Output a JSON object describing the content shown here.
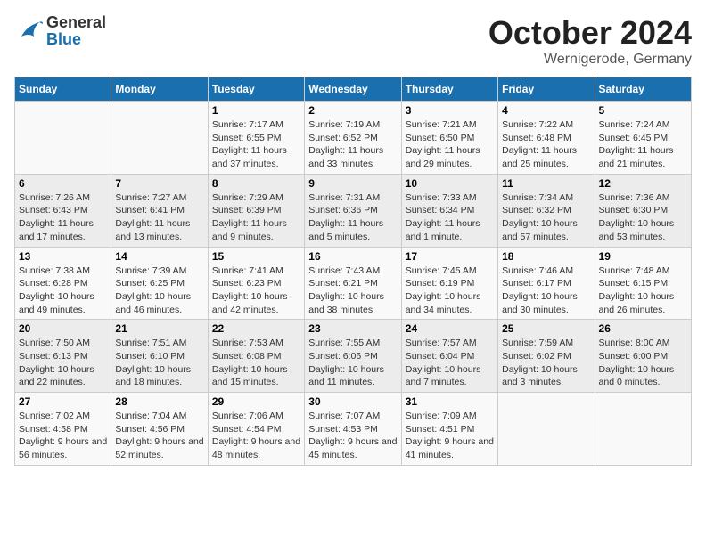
{
  "header": {
    "logo_general": "General",
    "logo_blue": "Blue",
    "month": "October 2024",
    "location": "Wernigerode, Germany"
  },
  "weekdays": [
    "Sunday",
    "Monday",
    "Tuesday",
    "Wednesday",
    "Thursday",
    "Friday",
    "Saturday"
  ],
  "weeks": [
    [
      {
        "day": "",
        "info": ""
      },
      {
        "day": "",
        "info": ""
      },
      {
        "day": "1",
        "info": "Sunrise: 7:17 AM\nSunset: 6:55 PM\nDaylight: 11 hours and 37 minutes."
      },
      {
        "day": "2",
        "info": "Sunrise: 7:19 AM\nSunset: 6:52 PM\nDaylight: 11 hours and 33 minutes."
      },
      {
        "day": "3",
        "info": "Sunrise: 7:21 AM\nSunset: 6:50 PM\nDaylight: 11 hours and 29 minutes."
      },
      {
        "day": "4",
        "info": "Sunrise: 7:22 AM\nSunset: 6:48 PM\nDaylight: 11 hours and 25 minutes."
      },
      {
        "day": "5",
        "info": "Sunrise: 7:24 AM\nSunset: 6:45 PM\nDaylight: 11 hours and 21 minutes."
      }
    ],
    [
      {
        "day": "6",
        "info": "Sunrise: 7:26 AM\nSunset: 6:43 PM\nDaylight: 11 hours and 17 minutes."
      },
      {
        "day": "7",
        "info": "Sunrise: 7:27 AM\nSunset: 6:41 PM\nDaylight: 11 hours and 13 minutes."
      },
      {
        "day": "8",
        "info": "Sunrise: 7:29 AM\nSunset: 6:39 PM\nDaylight: 11 hours and 9 minutes."
      },
      {
        "day": "9",
        "info": "Sunrise: 7:31 AM\nSunset: 6:36 PM\nDaylight: 11 hours and 5 minutes."
      },
      {
        "day": "10",
        "info": "Sunrise: 7:33 AM\nSunset: 6:34 PM\nDaylight: 11 hours and 1 minute."
      },
      {
        "day": "11",
        "info": "Sunrise: 7:34 AM\nSunset: 6:32 PM\nDaylight: 10 hours and 57 minutes."
      },
      {
        "day": "12",
        "info": "Sunrise: 7:36 AM\nSunset: 6:30 PM\nDaylight: 10 hours and 53 minutes."
      }
    ],
    [
      {
        "day": "13",
        "info": "Sunrise: 7:38 AM\nSunset: 6:28 PM\nDaylight: 10 hours and 49 minutes."
      },
      {
        "day": "14",
        "info": "Sunrise: 7:39 AM\nSunset: 6:25 PM\nDaylight: 10 hours and 46 minutes."
      },
      {
        "day": "15",
        "info": "Sunrise: 7:41 AM\nSunset: 6:23 PM\nDaylight: 10 hours and 42 minutes."
      },
      {
        "day": "16",
        "info": "Sunrise: 7:43 AM\nSunset: 6:21 PM\nDaylight: 10 hours and 38 minutes."
      },
      {
        "day": "17",
        "info": "Sunrise: 7:45 AM\nSunset: 6:19 PM\nDaylight: 10 hours and 34 minutes."
      },
      {
        "day": "18",
        "info": "Sunrise: 7:46 AM\nSunset: 6:17 PM\nDaylight: 10 hours and 30 minutes."
      },
      {
        "day": "19",
        "info": "Sunrise: 7:48 AM\nSunset: 6:15 PM\nDaylight: 10 hours and 26 minutes."
      }
    ],
    [
      {
        "day": "20",
        "info": "Sunrise: 7:50 AM\nSunset: 6:13 PM\nDaylight: 10 hours and 22 minutes."
      },
      {
        "day": "21",
        "info": "Sunrise: 7:51 AM\nSunset: 6:10 PM\nDaylight: 10 hours and 18 minutes."
      },
      {
        "day": "22",
        "info": "Sunrise: 7:53 AM\nSunset: 6:08 PM\nDaylight: 10 hours and 15 minutes."
      },
      {
        "day": "23",
        "info": "Sunrise: 7:55 AM\nSunset: 6:06 PM\nDaylight: 10 hours and 11 minutes."
      },
      {
        "day": "24",
        "info": "Sunrise: 7:57 AM\nSunset: 6:04 PM\nDaylight: 10 hours and 7 minutes."
      },
      {
        "day": "25",
        "info": "Sunrise: 7:59 AM\nSunset: 6:02 PM\nDaylight: 10 hours and 3 minutes."
      },
      {
        "day": "26",
        "info": "Sunrise: 8:00 AM\nSunset: 6:00 PM\nDaylight: 10 hours and 0 minutes."
      }
    ],
    [
      {
        "day": "27",
        "info": "Sunrise: 7:02 AM\nSunset: 4:58 PM\nDaylight: 9 hours and 56 minutes."
      },
      {
        "day": "28",
        "info": "Sunrise: 7:04 AM\nSunset: 4:56 PM\nDaylight: 9 hours and 52 minutes."
      },
      {
        "day": "29",
        "info": "Sunrise: 7:06 AM\nSunset: 4:54 PM\nDaylight: 9 hours and 48 minutes."
      },
      {
        "day": "30",
        "info": "Sunrise: 7:07 AM\nSunset: 4:53 PM\nDaylight: 9 hours and 45 minutes."
      },
      {
        "day": "31",
        "info": "Sunrise: 7:09 AM\nSunset: 4:51 PM\nDaylight: 9 hours and 41 minutes."
      },
      {
        "day": "",
        "info": ""
      },
      {
        "day": "",
        "info": ""
      }
    ]
  ]
}
